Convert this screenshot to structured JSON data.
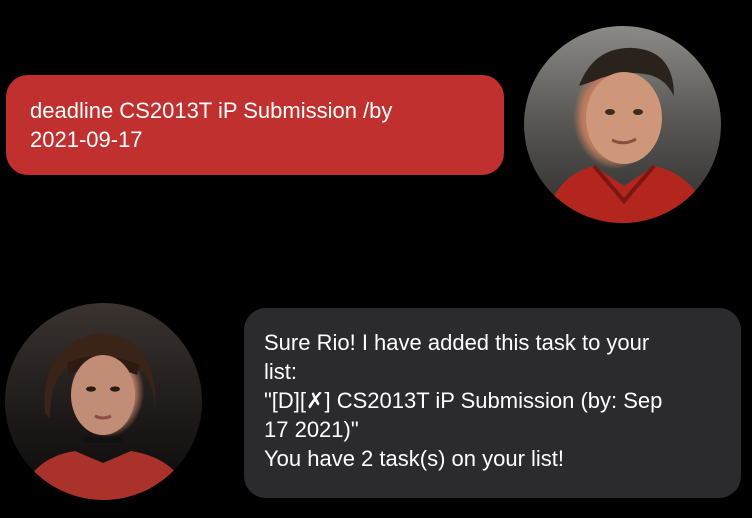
{
  "messages": {
    "user": {
      "lines": [
        "deadline CS2013T iP Submission /by",
        "2021-09-17"
      ]
    },
    "bot": {
      "lines": [
        "Sure Rio! I have added this task to your",
        "list:",
        "\"[D][✗] CS2013T iP Submission (by: Sep",
        "17 2021)\"",
        "You have 2 task(s) on your list!"
      ]
    }
  },
  "colors": {
    "background": "#000000",
    "user_bubble": "#c0302e",
    "bot_bubble": "#2b2b2d",
    "text": "#ffffff"
  }
}
